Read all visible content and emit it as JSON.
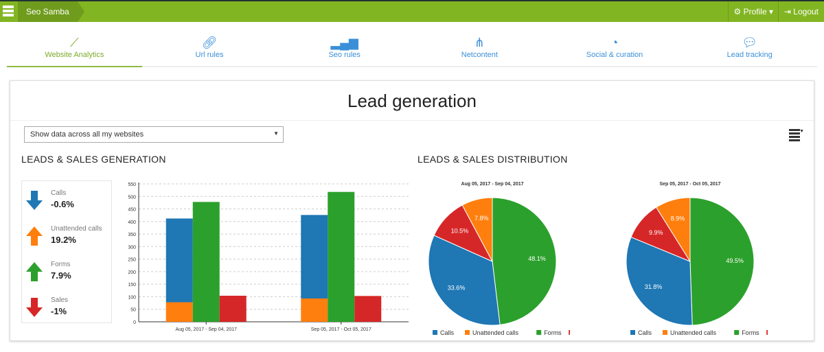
{
  "topbar": {
    "brand": "Seo Samba",
    "profile": "Profile",
    "logout": "Logout"
  },
  "tabs": [
    {
      "label": "Website Analytics",
      "icon": "trend-icon"
    },
    {
      "label": "Url rules",
      "icon": "link-icon"
    },
    {
      "label": "Seo rules",
      "icon": "bar-chart-icon"
    },
    {
      "label": "Netcontent",
      "icon": "network-icon"
    },
    {
      "label": "Social & curation",
      "icon": "pie-icon"
    },
    {
      "label": "Lead tracking",
      "icon": "sms-icon"
    }
  ],
  "page": {
    "title": "Lead generation",
    "select": "Show data across all my websites"
  },
  "sections": {
    "generation": "LEADS & SALES GENERATION",
    "distribution": "LEADS & SALES DISTRIBUTION"
  },
  "kpis": [
    {
      "label": "Calls",
      "value": "-0.6%",
      "dir": "down",
      "color": "#1f77b4"
    },
    {
      "label": "Unattended calls",
      "value": "19.2%",
      "dir": "up",
      "color": "#ff7f0e"
    },
    {
      "label": "Forms",
      "value": "7.9%",
      "dir": "up",
      "color": "#2ca02c"
    },
    {
      "label": "Sales",
      "value": "-1%",
      "dir": "down",
      "color": "#d62728"
    }
  ],
  "colors": {
    "Calls": "#1f77b4",
    "Unattended calls": "#ff7f0e",
    "Forms": "#2ca02c",
    "Sales": "#d62728"
  },
  "chart_data": [
    {
      "type": "bar",
      "title": "",
      "ylim": [
        0,
        550
      ],
      "yticks": [
        0,
        50,
        100,
        150,
        200,
        250,
        300,
        350,
        400,
        450,
        500,
        550
      ],
      "categories": [
        "Aug 05, 2017 - Sep 04, 2017",
        "Sep 05, 2017 - Oct 05, 2017"
      ],
      "series": [
        {
          "name": "Unattended calls",
          "values": [
            78,
            93
          ],
          "stack": "calls"
        },
        {
          "name": "Calls",
          "values": [
            334,
            333
          ],
          "stack": "calls"
        },
        {
          "name": "Forms",
          "values": [
            478,
            518
          ]
        },
        {
          "name": "Sales",
          "values": [
            104,
            103
          ]
        }
      ]
    },
    {
      "type": "pie",
      "title": "Aug 05, 2017 - Sep 04, 2017",
      "slices": [
        {
          "name": "Forms",
          "value": 48.1,
          "label": "48.1%"
        },
        {
          "name": "Calls",
          "value": 33.6,
          "label": "33.6%"
        },
        {
          "name": "Sales",
          "value": 10.5,
          "label": "10.5%"
        },
        {
          "name": "Unattended calls",
          "value": 7.8,
          "label": "7.8%"
        }
      ],
      "legend": [
        "Calls",
        "Unattended calls",
        "Forms",
        "Sales"
      ]
    },
    {
      "type": "pie",
      "title": "Sep 05, 2017 - Oct 05, 2017",
      "slices": [
        {
          "name": "Forms",
          "value": 49.5,
          "label": "49.5%"
        },
        {
          "name": "Calls",
          "value": 31.8,
          "label": "31.8%"
        },
        {
          "name": "Sales",
          "value": 9.9,
          "label": "9.9%"
        },
        {
          "name": "Unattended calls",
          "value": 8.9,
          "label": "8.9%"
        }
      ],
      "legend": [
        "Calls",
        "Unattended calls",
        "Forms",
        "Sales"
      ]
    }
  ]
}
